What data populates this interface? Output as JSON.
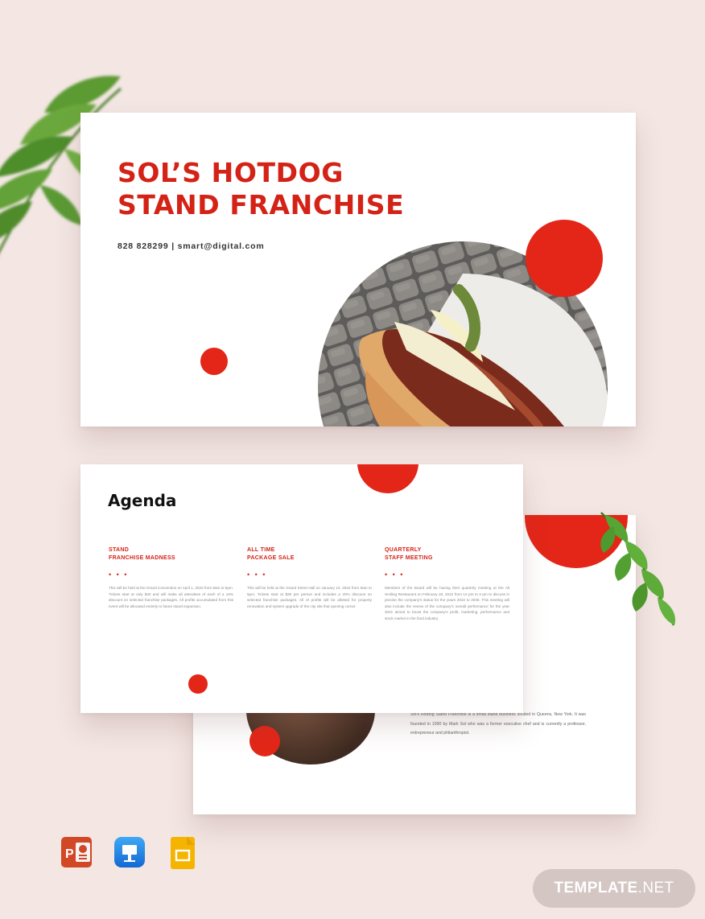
{
  "main_slide": {
    "title": "SOL’S HOTDOG\nSTAND FRANCHISE",
    "contact": "828 828299 | smart@digital.com"
  },
  "agenda_slide": {
    "title": "Agenda",
    "columns": [
      {
        "heading": "STAND\nFRANCHISE MADNESS",
        "stars": "• • •",
        "body": "This will be held at the Grand Convention on April 1, 2022 from 9am to 5pm. Tickets start at only $30 and will make all attendees of each of a 16% discount on selected franchise packages. All profits accumulated from this event will be allocated entirely to future stand expansion."
      },
      {
        "heading": "ALL TIME\nPACKAGE SALE",
        "stars": "• • •",
        "body": "This will be held at the Grand Street Hall on January 10, 2022 from 9am to 5pm. Tickets start at $30 per person and includes a 20% discount on selected franchise packages. All of profits will be allotted for property renovation and system upgrade of the city site that opening corner."
      },
      {
        "heading": "QUARTERLY\nSTAFF MEETING",
        "stars": "• • •",
        "body": "Members of the Board will be having their quarterly meeting at the All Smiling Restaurant on February 20, 2022 from 12 pm to 3 pm to discuss in precise the company's status for the years 2022 to 2030. This meeting will also include the review of the company's overall performance for the year 2021 aimed to boost the company's profit, marketing, performance and stock market in the food industry."
      }
    ]
  },
  "back_slide": {
    "text": "Sol's Hotdog Stand Franchise is a small stand business located in Queens, New York. It was founded in 1990 by Mark Sol who was a former executive chef and is currently a professor, entrepreneur and philanthropist."
  },
  "app_icons": [
    "powerpoint-icon",
    "keynote-icon",
    "google-slides-icon"
  ],
  "badge": {
    "brand": "TEMPLATE",
    "suffix": ".NET"
  },
  "colors": {
    "accent": "#e32618",
    "background": "#f3e6e3",
    "badge": "#d3c6c3"
  }
}
